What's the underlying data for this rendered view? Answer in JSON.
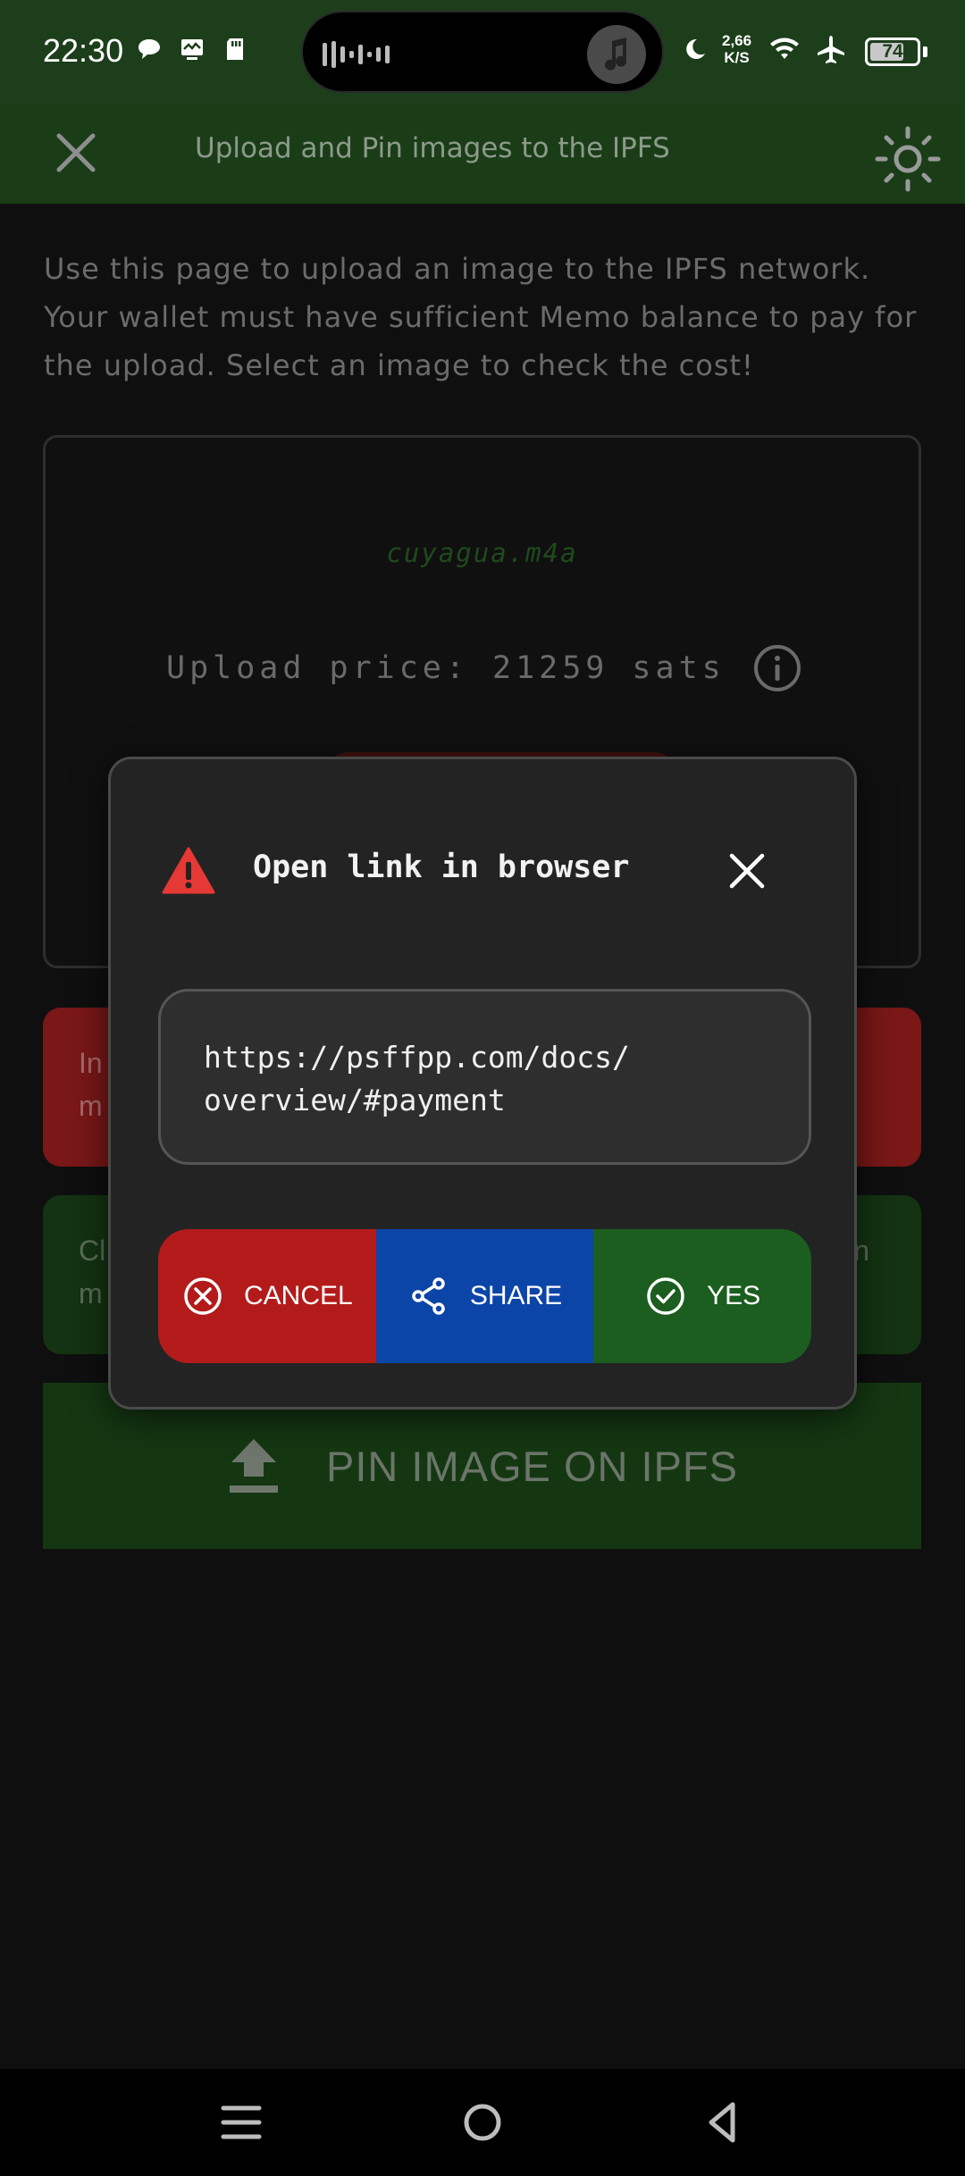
{
  "status_bar": {
    "time": "22:30",
    "net_speed_value": "2,66",
    "net_speed_unit": "K/S",
    "battery": "74",
    "battery_level": 0.74,
    "icons": [
      "chat-icon",
      "monitor-icon",
      "sd-card-icon",
      "music-icon",
      "moon-icon",
      "wifi-icon",
      "airplane-icon",
      "battery-icon"
    ]
  },
  "app_bar": {
    "title": "Upload and Pin images to the IPFS",
    "close_icon": "close-icon",
    "theme_icon": "sun-icon"
  },
  "page": {
    "description": "Use this page to upload an image to the IPFS network. Your wallet must have sufficient Memo balance to pay for the upload. Select an image to check the cost!",
    "filename": "cuyagua.m4a",
    "upload_price": "Upload price: 21259 sats",
    "red_banner_line1": "In",
    "red_banner_line2": "m",
    "green_banner_line1": "Cl",
    "green_banner_line2": "m",
    "green_banner_right": "n",
    "pin_button_label": "PIN IMAGE ON IPFS"
  },
  "dialog": {
    "title": "Open link in browser",
    "url_line1": "https://psffpp.com/docs/",
    "url_line2": "overview/#payment",
    "cancel_label": "CANCEL",
    "share_label": "SHARE",
    "yes_label": "YES"
  },
  "colors": {
    "app_bar": "#1a3d18",
    "dialog_bg": "#232323",
    "cancel": "#b31b1b",
    "share": "#0c45a8",
    "yes": "#1b5e20",
    "warning": "#e53935"
  }
}
